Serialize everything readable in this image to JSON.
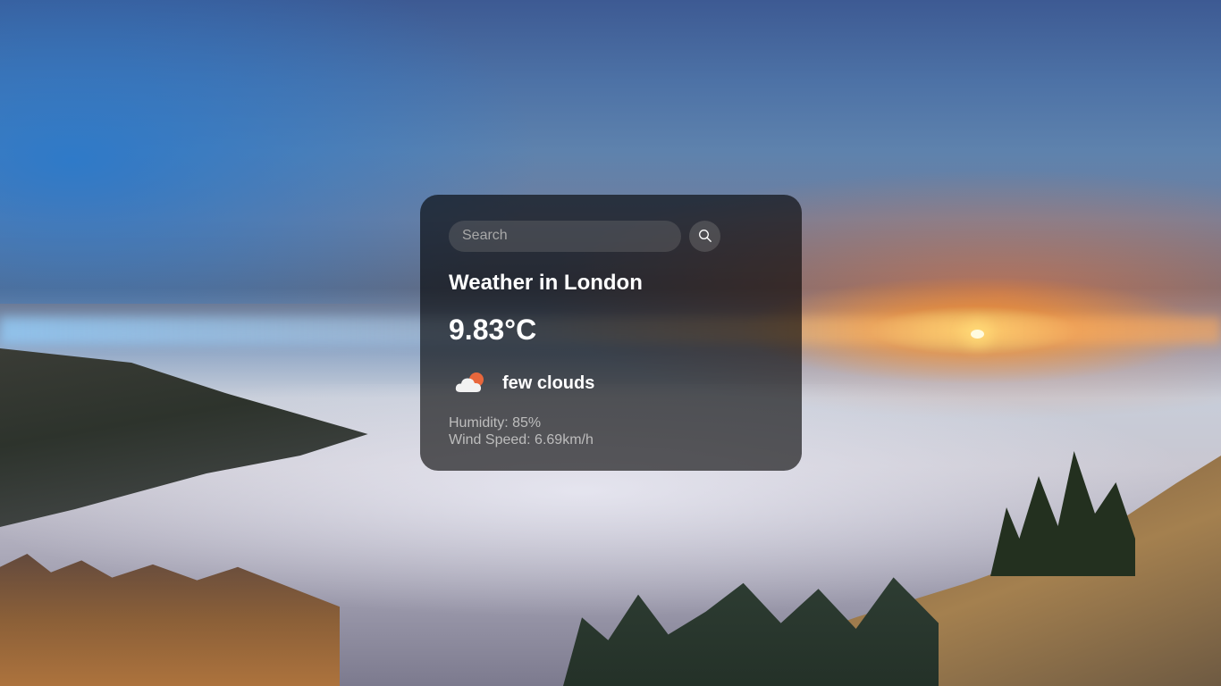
{
  "search": {
    "placeholder": "Search",
    "value": ""
  },
  "weather": {
    "title": "Weather in London",
    "temperature": "9.83°C",
    "description": "few clouds",
    "icon": "few-clouds-icon",
    "humidity": "Humidity: 85%",
    "wind": "Wind Speed: 6.69km/h"
  },
  "icons": {
    "search": "search-icon",
    "weather": "few-clouds-icon"
  },
  "colors": {
    "card_background": "#000000",
    "text": "#ffffff",
    "secondary_text": "#bdbdbd",
    "sun_accent": "#e8673c"
  }
}
